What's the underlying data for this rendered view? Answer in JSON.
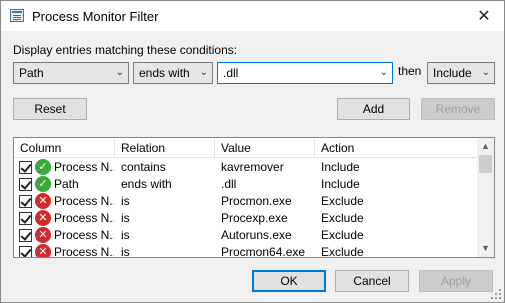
{
  "window": {
    "title": "Process Monitor Filter"
  },
  "prompt": "Display entries matching these conditions:",
  "condition": {
    "column": "Path",
    "relation": "ends with",
    "value": ".dll",
    "then_label": "then",
    "action": "Include"
  },
  "buttons": {
    "reset": "Reset",
    "add": "Add",
    "remove": "Remove",
    "ok": "OK",
    "cancel": "Cancel",
    "apply": "Apply"
  },
  "list": {
    "headers": [
      "Column",
      "Relation",
      "Value",
      "Action"
    ],
    "rows": [
      {
        "column": "Process N...",
        "relation": "contains",
        "value": "kavremover",
        "action": "Include",
        "status": "include"
      },
      {
        "column": "Path",
        "relation": "ends with",
        "value": ".dll",
        "action": "Include",
        "status": "include"
      },
      {
        "column": "Process N...",
        "relation": "is",
        "value": "Procmon.exe",
        "action": "Exclude",
        "status": "exclude"
      },
      {
        "column": "Process N...",
        "relation": "is",
        "value": "Procexp.exe",
        "action": "Exclude",
        "status": "exclude"
      },
      {
        "column": "Process N...",
        "relation": "is",
        "value": "Autoruns.exe",
        "action": "Exclude",
        "status": "exclude"
      },
      {
        "column": "Process N...",
        "relation": "is",
        "value": "Procmon64.exe",
        "action": "Exclude",
        "status": "exclude"
      }
    ]
  },
  "colors": {
    "include": "#3aa83a",
    "exclude": "#d12b2b",
    "focus": "#0078d7"
  }
}
